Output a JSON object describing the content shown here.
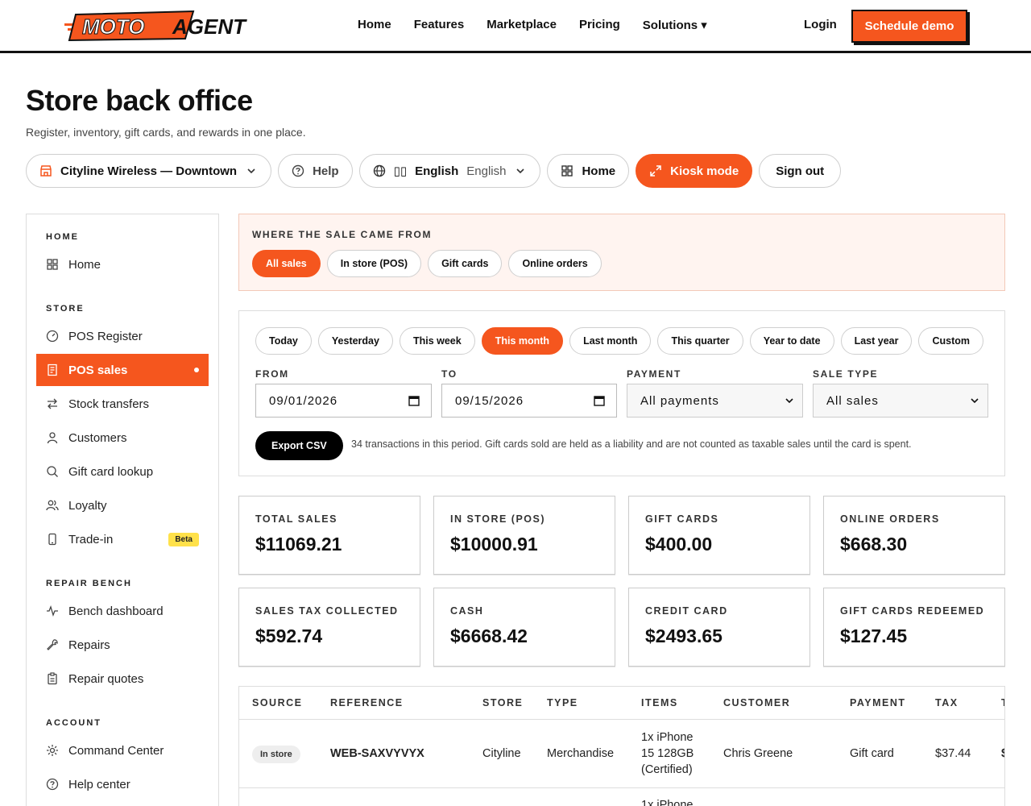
{
  "brand": {
    "logo_text_1": "MOTO",
    "logo_text_2": "AGENT"
  },
  "nav": {
    "links": [
      "Home",
      "Features",
      "Marketplace",
      "Pricing",
      "Solutions ▾"
    ],
    "login": "Login",
    "demo": "Schedule demo"
  },
  "header": {
    "title": "Store back office",
    "subtitle": "Register, inventory, gift cards, and rewards in one place."
  },
  "toolbar": {
    "store": "Cityline Wireless — Downtown",
    "help": "Help",
    "lang_flag": "▯▯",
    "lang": "English",
    "lang_secondary": "English",
    "home": "Home",
    "kiosk": "Kiosk mode",
    "signout": "Sign out"
  },
  "sidebar": {
    "sec_home": "HOME",
    "home": "Home",
    "sec_store": "STORE",
    "pos_register": "POS Register",
    "pos_sales": "POS sales",
    "stock_transfers": "Stock transfers",
    "customers": "Customers",
    "gift_card_lookup": "Gift card lookup",
    "loyalty": "Loyalty",
    "trade_in": "Trade-in",
    "beta": "Beta",
    "sec_repair": "REPAIR BENCH",
    "bench_dashboard": "Bench dashboard",
    "repairs": "Repairs",
    "repair_quotes": "Repair quotes",
    "sec_account": "ACCOUNT",
    "command_center": "Command Center",
    "help_center": "Help center"
  },
  "source": {
    "label": "WHERE THE SALE CAME FROM",
    "chips": [
      "All sales",
      "In store (POS)",
      "Gift cards",
      "Online orders"
    ],
    "selected": "All sales"
  },
  "filters": {
    "periods": [
      "Today",
      "Yesterday",
      "This week",
      "This month",
      "Last month",
      "This quarter",
      "Year to date",
      "Last year",
      "Custom"
    ],
    "selected_period": "This month",
    "from_label": "FROM",
    "from_value": "09/01/2026",
    "to_label": "TO",
    "to_value": "09/15/2026",
    "payment_label": "PAYMENT",
    "payment_value": "All payments",
    "saletype_label": "SALE TYPE",
    "saletype_value": "All sales",
    "export": "Export CSV",
    "note": "34 transactions in this period. Gift cards sold are held as a liability and are not counted as taxable sales until the card is spent."
  },
  "stats": [
    {
      "label": "TOTAL SALES",
      "value": "$11069.21"
    },
    {
      "label": "IN STORE (POS)",
      "value": "$10000.91"
    },
    {
      "label": "GIFT CARDS",
      "value": "$400.00"
    },
    {
      "label": "ONLINE ORDERS",
      "value": "$668.30"
    },
    {
      "label": "SALES TAX COLLECTED",
      "value": "$592.74"
    },
    {
      "label": "CASH",
      "value": "$6668.42"
    },
    {
      "label": "CREDIT CARD",
      "value": "$2493.65"
    },
    {
      "label": "GIFT CARDS REDEEMED",
      "value": "$127.45"
    }
  ],
  "table": {
    "headers": [
      "SOURCE",
      "REFERENCE",
      "STORE",
      "TYPE",
      "ITEMS",
      "CUSTOMER",
      "PAYMENT",
      "TAX",
      "T"
    ],
    "rows": [
      {
        "source": "In store",
        "reference": "WEB-SAXVYVYX",
        "store": "Cityline",
        "type": "Merchandise",
        "items_1": "1x iPhone",
        "items_2": "15 128GB",
        "items_3": "(Certified)",
        "customer": "Chris Greene",
        "payment": "Gift card",
        "tax": "$37.44",
        "total_partial": "$"
      }
    ],
    "next_row_items": "1x iPhone"
  },
  "colors": {
    "accent": "#f5561e",
    "beta": "#ffe14a",
    "source_bg": "#fff4f0"
  }
}
